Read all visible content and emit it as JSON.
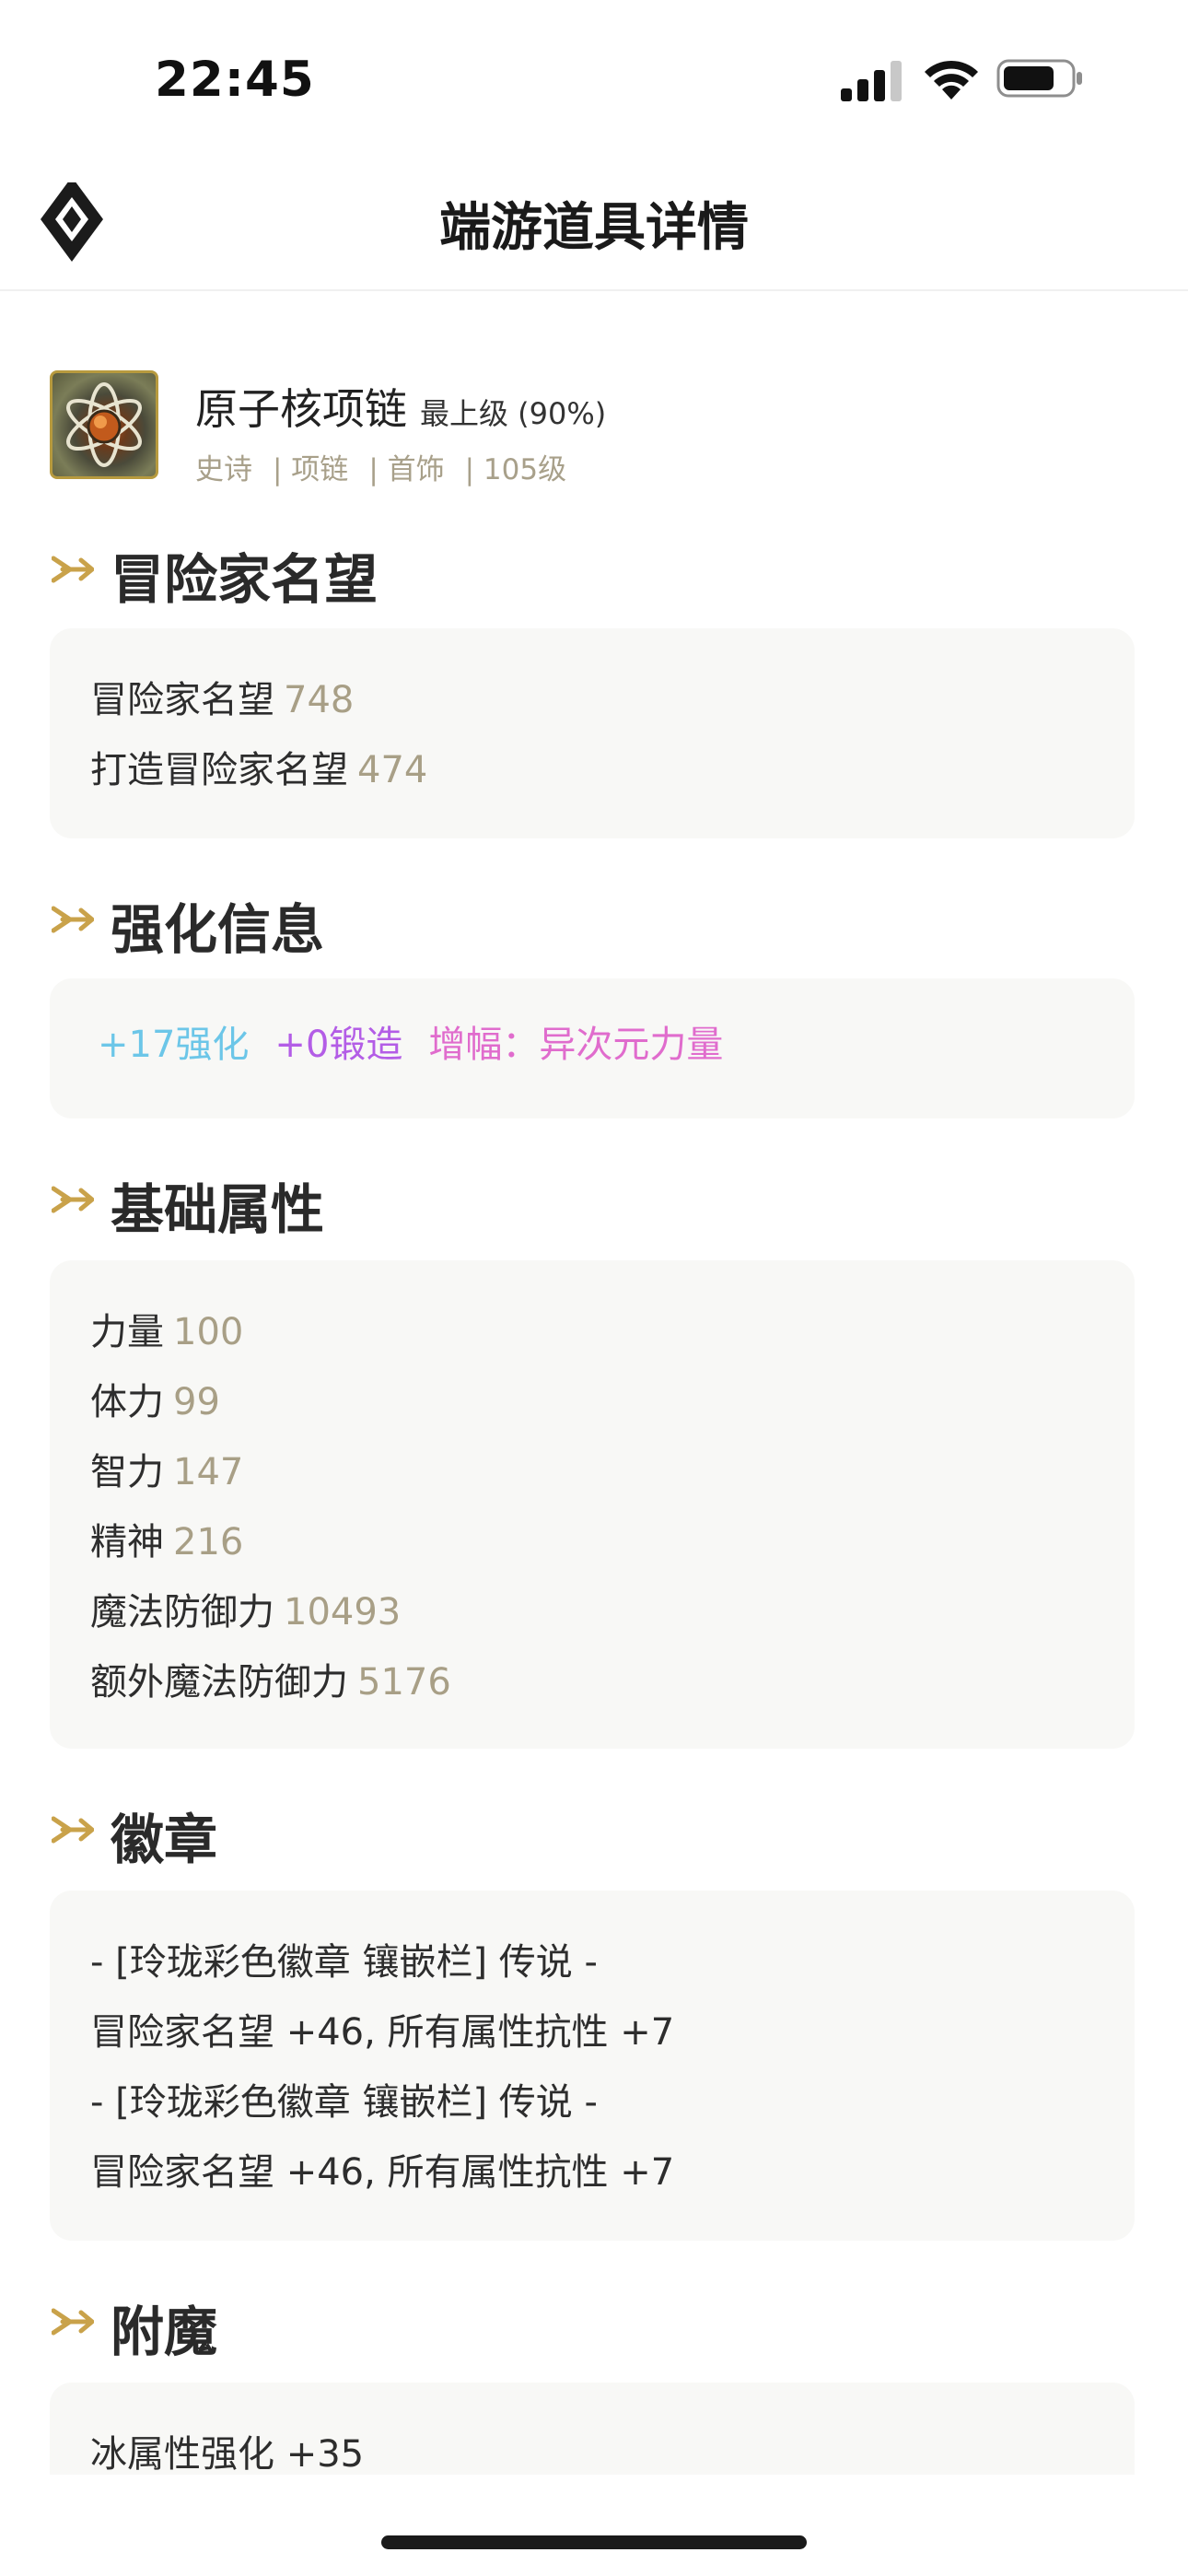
{
  "status_bar": {
    "time": "22:45",
    "icons": [
      "cellular-signal-icon",
      "wifi-icon",
      "battery-icon"
    ]
  },
  "nav": {
    "title": "端游道具详情",
    "logo_icon": "diamond-logo-icon"
  },
  "item": {
    "name": "原子核项链",
    "grade": "最上级 (90%)",
    "meta": [
      "史诗",
      "| 项链",
      "| 首饰",
      "| 105级"
    ],
    "icon": "atom-necklace-icon"
  },
  "sections": {
    "reputation": {
      "title": "冒险家名望",
      "lines": [
        {
          "label": "冒险家名望",
          "value": "748"
        },
        {
          "label": "打造冒险家名望",
          "value": "474"
        }
      ]
    },
    "enhance": {
      "title": "强化信息",
      "enhance": "+17强化",
      "forge": "+0锻造",
      "amplify": "增幅：异次元力量"
    },
    "base_stats": {
      "title": "基础属性",
      "lines": [
        {
          "label": "力量",
          "value": "100"
        },
        {
          "label": "体力",
          "value": "99"
        },
        {
          "label": "智力",
          "value": "147"
        },
        {
          "label": "精神",
          "value": "216"
        },
        {
          "label": "魔法防御力",
          "value": "10493"
        },
        {
          "label": "额外魔法防御力",
          "value": "5176"
        }
      ]
    },
    "emblem": {
      "title": "徽章",
      "lines": [
        "- [玲珑彩色徽章 镶嵌栏] 传说 -",
        "冒险家名望 +46, 所有属性抗性 +7",
        "- [玲珑彩色徽章 镶嵌栏] 传说 -",
        "冒险家名望 +46, 所有属性抗性 +7"
      ]
    },
    "enchant": {
      "title": "附魔",
      "lines": [
        "冰属性强化 +35"
      ]
    }
  },
  "colors": {
    "accent_gold": "#c9a24a",
    "value_gray": "#a89f86",
    "enhance_blue": "#6cc6e8",
    "forge_purple": "#b35de6",
    "amplify_pink": "#e06ccd",
    "card_bg": "#f8f8f6"
  }
}
